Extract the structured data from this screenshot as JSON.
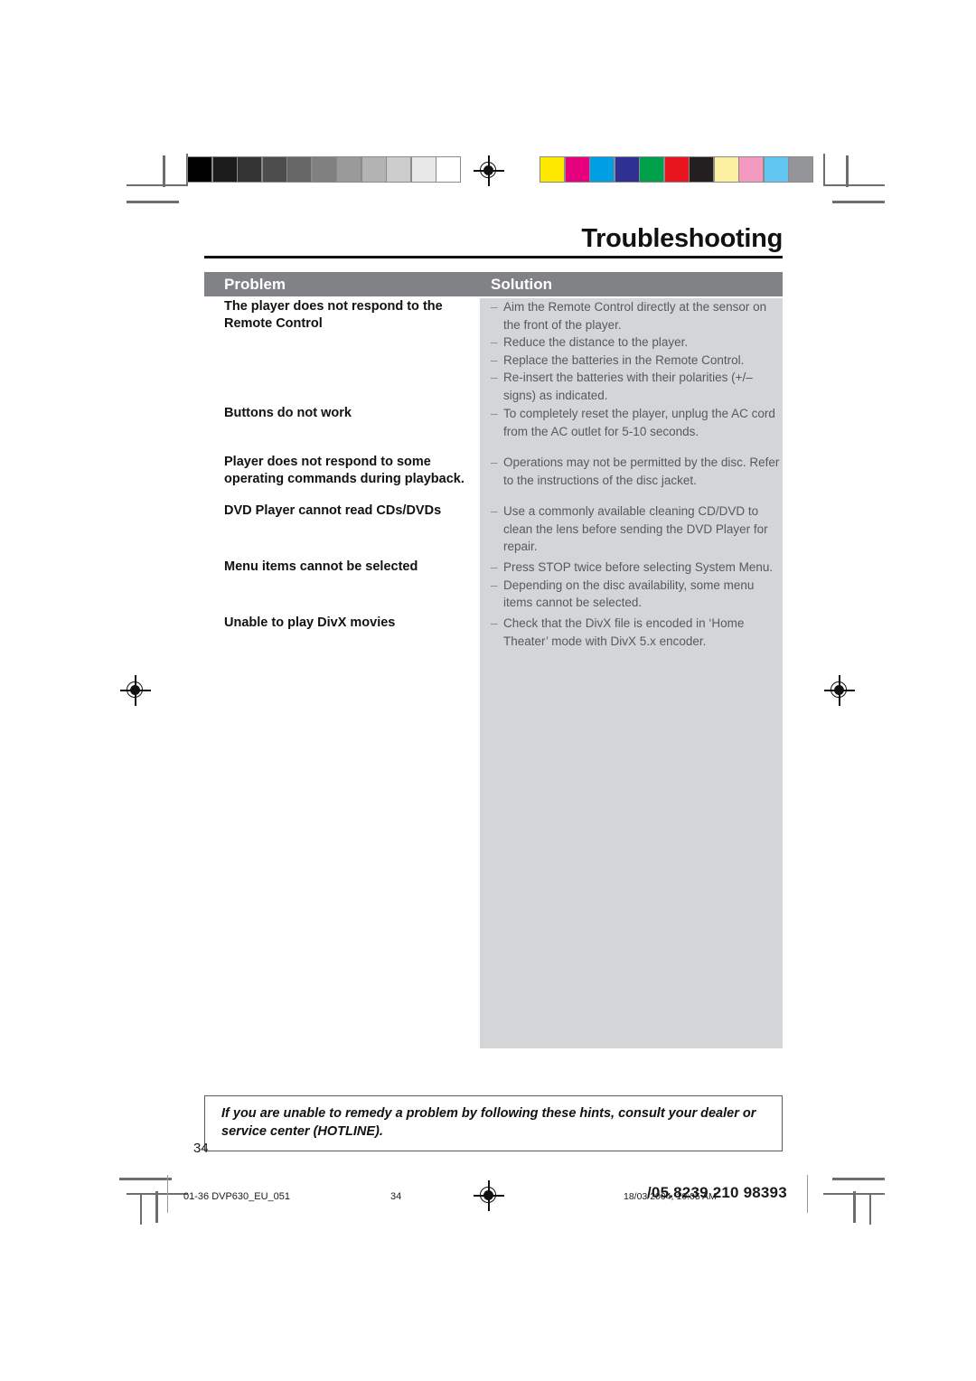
{
  "document": {
    "title": "Troubleshooting",
    "page_number": "34"
  },
  "table": {
    "headers": {
      "problem": "Problem",
      "solution": "Solution"
    },
    "rows": [
      {
        "problem": "The player does not respond to the Remote Control",
        "solutions": [
          "Aim the Remote Control directly at the sensor on the front of the player.",
          "Reduce the distance to the player.",
          "Replace the batteries in the Remote Control.",
          "Re-insert the batteries with their polarities (+/– signs) as indicated."
        ]
      },
      {
        "problem": "Buttons do not work",
        "solutions": [
          "To completely reset the player, unplug the AC cord from the AC outlet for 5-10 seconds."
        ]
      },
      {
        "problem": "Player does not respond to some operating commands during playback.",
        "solutions": [
          "Operations may not be permitted by the disc. Refer to the instructions of  the disc jacket."
        ]
      },
      {
        "problem": "DVD Player cannot read CDs/DVDs",
        "solutions": [
          "Use a commonly available cleaning CD/DVD to clean the lens before sending the DVD Player for repair."
        ]
      },
      {
        "problem": "Menu items cannot be selected",
        "solutions": [
          "Press STOP twice before selecting System Menu.",
          "Depending on the disc availability, some menu items cannot be selected."
        ]
      },
      {
        "problem": "Unable to play DivX movies",
        "solutions": [
          "Check that the DivX file is encoded in ‘Home Theater’ mode with DivX 5.x encoder."
        ]
      }
    ]
  },
  "note": "If you are unable to remedy a problem by following these hints, consult your dealer or service center (HOTLINE).",
  "printer_footer": {
    "file_label": "01-36 DVP630_EU_051",
    "page_label": "34",
    "timestamp": "18/03/2004, 10:05 AM",
    "code": "/05.8239 210 98393"
  },
  "calibration": {
    "grayscale": [
      "#000000",
      "#1c1c1c",
      "#333333",
      "#4d4d4d",
      "#676767",
      "#808080",
      "#9a9a9a",
      "#b3b3b3",
      "#cdcdcd",
      "#e8e8e8",
      "#ffffff"
    ],
    "color": [
      "#ffe800",
      "#e6007e",
      "#009ee3",
      "#2e3192",
      "#00a04a",
      "#e8151e",
      "#231f20",
      "#faf0a0",
      "#f49ac1",
      "#62c6f2",
      "#939598"
    ]
  }
}
